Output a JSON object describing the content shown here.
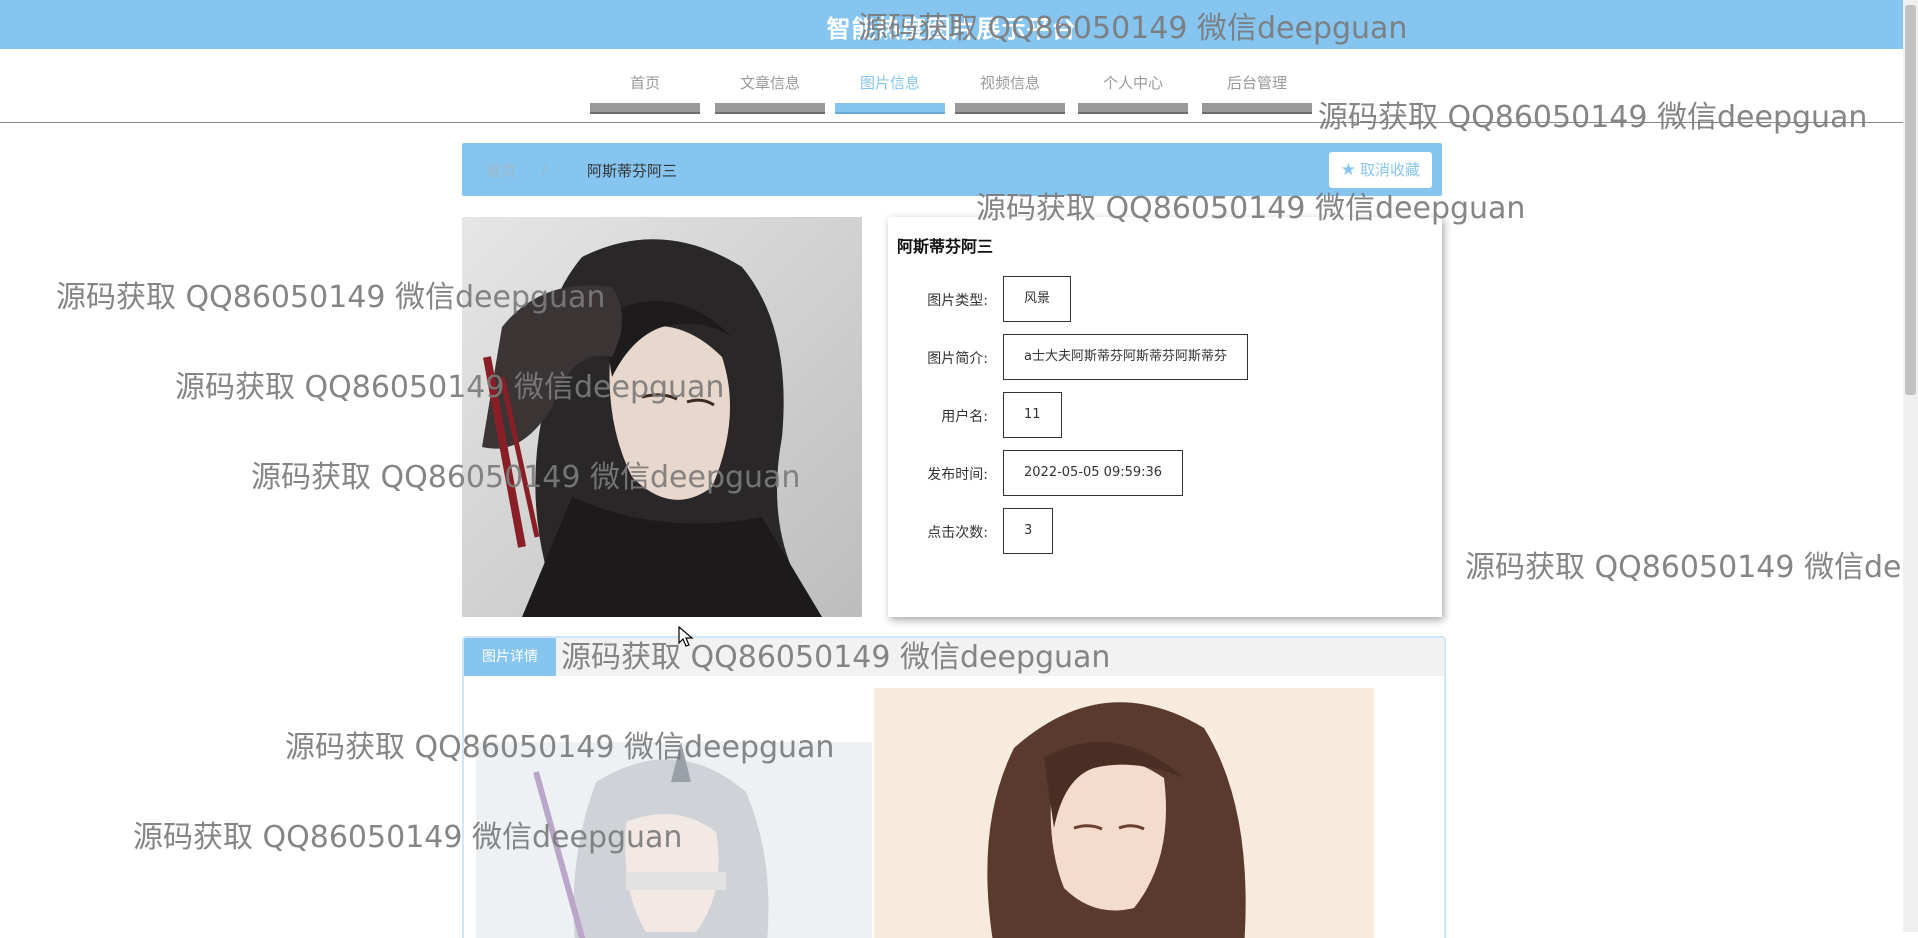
{
  "site": {
    "title": "智能热度图片展示平台"
  },
  "nav": {
    "items": [
      {
        "label": "首页"
      },
      {
        "label": "文章信息"
      },
      {
        "label": "图片信息"
      },
      {
        "label": "视频信息"
      },
      {
        "label": "个人中心"
      },
      {
        "label": "后台管理"
      }
    ],
    "active_index": 2
  },
  "breadcrumb": {
    "home": "首页",
    "separator": "/",
    "current": "阿斯蒂芬阿三"
  },
  "favorite_button": {
    "label": "取消收藏",
    "icon": "star-icon"
  },
  "detail": {
    "title": "阿斯蒂芬阿三",
    "fields": [
      {
        "label": "图片类型:",
        "value": "风景"
      },
      {
        "label": "图片简介:",
        "value": "a士大夫阿斯蒂芬阿斯蒂芬阿斯蒂芬"
      },
      {
        "label": "用户名:",
        "value": "11"
      },
      {
        "label": "发布时间:",
        "value": "2022-05-05 09:59:36"
      },
      {
        "label": "点击次数:",
        "value": "3"
      }
    ]
  },
  "tabs": [
    {
      "label": "图片详情"
    }
  ],
  "watermark": {
    "text": "源码获取 QQ86050149 微信deepguan"
  },
  "colors": {
    "primary": "#86c5ef",
    "nav_inactive_bar": "#9a9a9a"
  }
}
